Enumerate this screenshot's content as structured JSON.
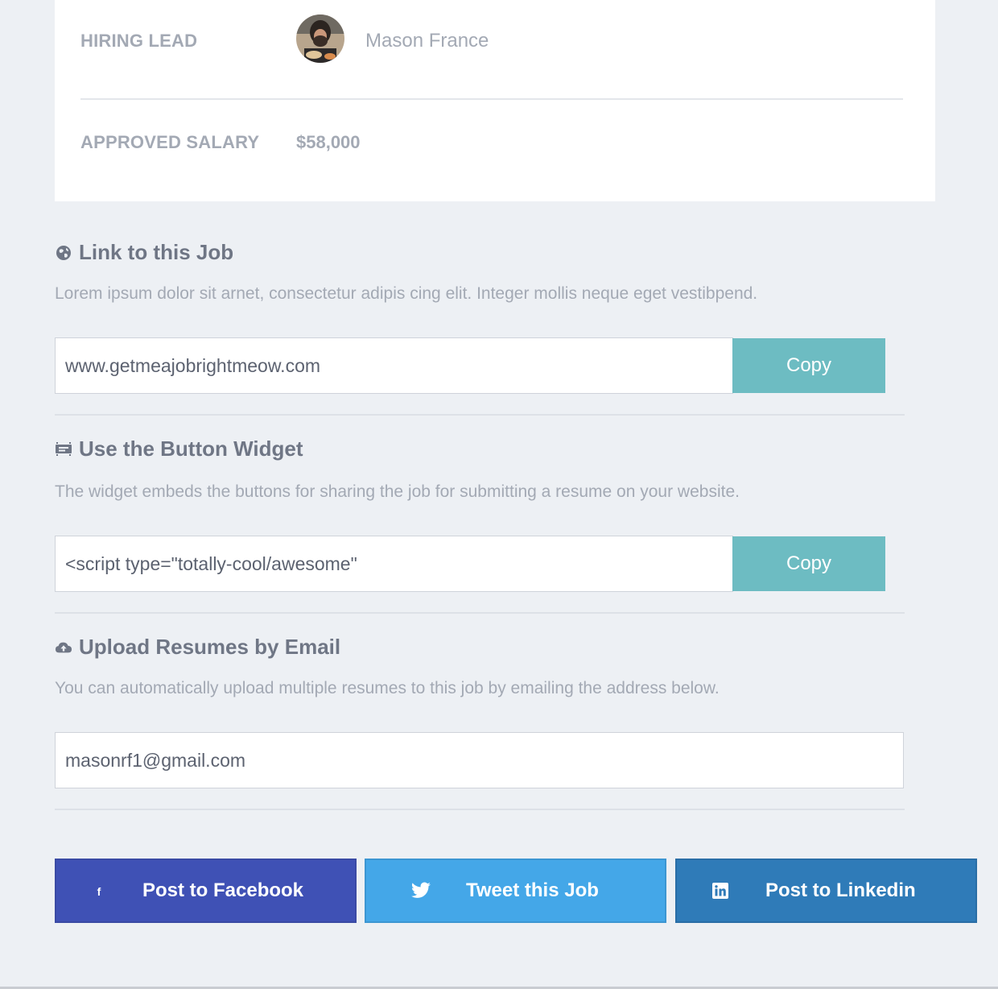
{
  "job_details": {
    "hiring_lead_label": "HIRING LEAD",
    "hiring_lead_name": "Mason France",
    "approved_salary_label": "APPROVED SALARY",
    "approved_salary_value": "$58,000"
  },
  "link_section": {
    "icon": "globe-icon",
    "title": "Link to this Job",
    "description": "Lorem ipsum dolor sit arnet, consectetur adipis cing elit. Integer mollis neque eget vestibpend.",
    "url_value": "www.getmeajobrightmeow.com",
    "copy_label": "Copy"
  },
  "widget_section": {
    "icon": "widget-icon",
    "title": "Use the Button Widget",
    "description": "The widget embeds the buttons for sharing the job for submitting a resume on your website.",
    "code_value": "<script type=\"totally-cool/awesome\"",
    "copy_label": "Copy"
  },
  "email_section": {
    "icon": "cloud-upload-icon",
    "title": "Upload Resumes by Email",
    "description": "You can automatically upload multiple resumes to this job by emailing the address below.",
    "email_value": "masonrf1@gmail.com"
  },
  "social": {
    "facebook_label": "Post to Facebook",
    "twitter_label": "Tweet this Job",
    "linkedin_label": "Post to Linkedin"
  },
  "colors": {
    "background": "#edf0f4",
    "copy_button": "#6dbcc2",
    "facebook": "#3f51b5",
    "twitter": "#44a7e8",
    "linkedin": "#2f7bb8"
  }
}
